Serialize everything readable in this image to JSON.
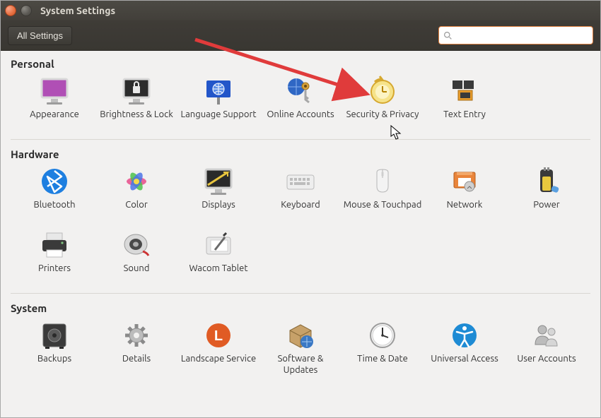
{
  "window": {
    "title": "System Settings"
  },
  "toolbar": {
    "all_settings": "All Settings",
    "search_placeholder": ""
  },
  "sections": {
    "personal": {
      "title": "Personal",
      "appearance": "Appearance",
      "brightness": "Brightness & Lock",
      "language": "Language Support",
      "online_accounts": "Online Accounts",
      "security": "Security & Privacy",
      "text_entry": "Text Entry"
    },
    "hardware": {
      "title": "Hardware",
      "bluetooth": "Bluetooth",
      "color": "Color",
      "displays": "Displays",
      "keyboard": "Keyboard",
      "mouse": "Mouse & Touchpad",
      "network": "Network",
      "power": "Power",
      "printers": "Printers",
      "sound": "Sound",
      "wacom": "Wacom Tablet"
    },
    "system": {
      "title": "System",
      "backups": "Backups",
      "details": "Details",
      "landscape": "Landscape Service",
      "software": "Software & Updates",
      "time": "Time & Date",
      "ua": "Universal Access",
      "users": "User Accounts"
    }
  }
}
